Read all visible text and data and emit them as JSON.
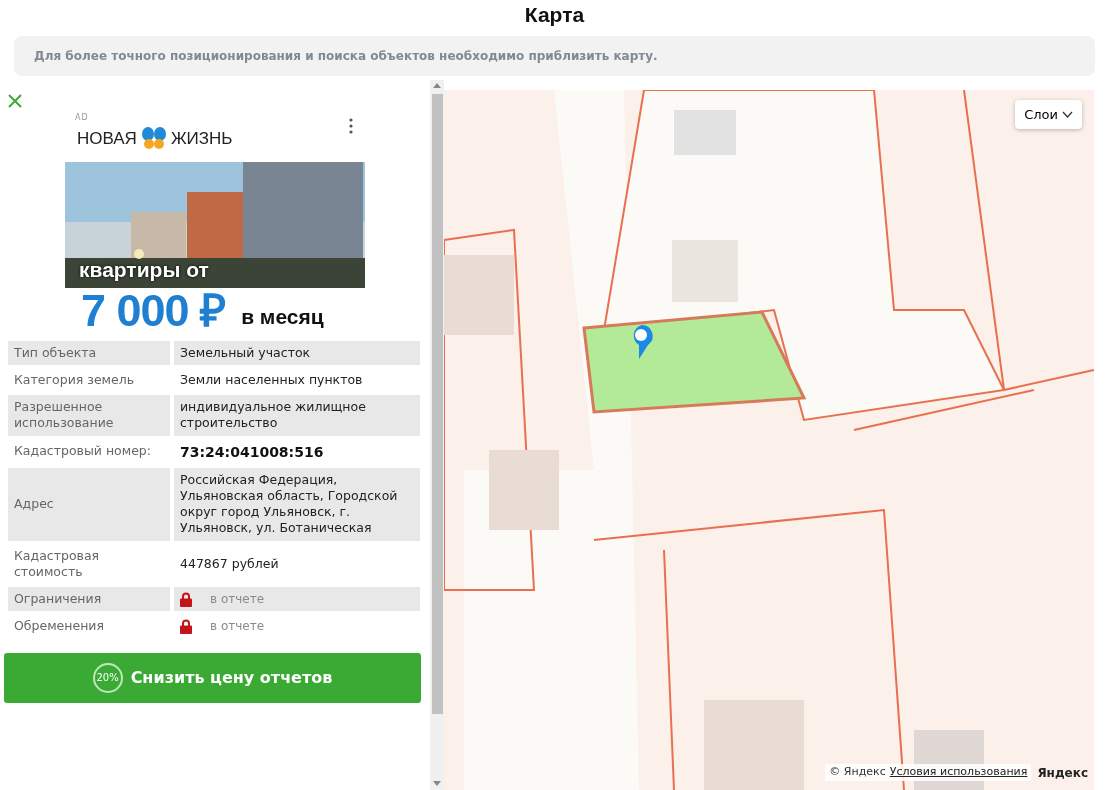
{
  "page_title": "Карта",
  "notice": "Для более точного позиционирования и поиска объектов необходимо приблизить карту.",
  "ad": {
    "label": "AD",
    "brand_left": "НОВАЯ",
    "brand_right": "ЖИЗНЬ",
    "headline": "квартиры от",
    "price": "7 000 ₽",
    "period": "в месяц"
  },
  "details": [
    {
      "label": "Тип объекта",
      "value": "Земельный участок",
      "kind": "text"
    },
    {
      "label": "Категория земель",
      "value": "Земли населенных пунктов",
      "kind": "text"
    },
    {
      "label": "Разрешенное использование",
      "value": "индивидуальное жилищное строительство",
      "kind": "text"
    },
    {
      "label": "Кадастровый номер:",
      "value": "73:24:041008:516",
      "kind": "bold"
    },
    {
      "label": "Адрес",
      "value": "Российская Федерация, Ульяновская область, Городской округ город Ульяновск, г. Ульяновск, ул. Ботаническая",
      "kind": "text"
    },
    {
      "label": "Кадастровая стоимость",
      "value": "447867 рублей",
      "kind": "text"
    },
    {
      "label": "Ограничения",
      "value": "в отчете",
      "kind": "locked"
    },
    {
      "label": "Обременения",
      "value": "в отчете",
      "kind": "locked"
    }
  ],
  "discount_button": {
    "badge": "20%",
    "label": "Снизить цену отчетов"
  },
  "map": {
    "layers_button": "Слои",
    "copyright": "© Яндекс",
    "terms_link": "Условия использования",
    "provider_logo": "Яндекс"
  }
}
